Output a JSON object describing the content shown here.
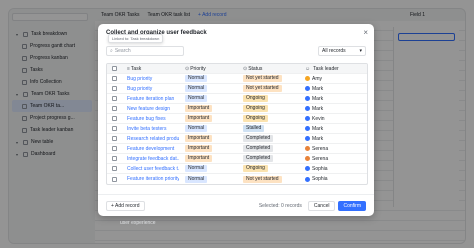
{
  "topbar": {
    "tabs": [
      "Team OKR Tasks",
      "Team OKR task list"
    ],
    "add_record": "+ Add record",
    "field_label": "Field 1"
  },
  "sidebar": {
    "items": [
      {
        "label": "Task breakdown",
        "level": 0
      },
      {
        "label": "Progress gantt chart",
        "level": 1
      },
      {
        "label": "Progress kanban",
        "level": 1
      },
      {
        "label": "Tasks",
        "level": 1
      },
      {
        "label": "Info Collection",
        "level": 1
      },
      {
        "label": "Team OKR Tasks",
        "level": 0
      },
      {
        "label": "Team OKR ta...",
        "level": 1
      },
      {
        "label": "Project progress g...",
        "level": 1
      },
      {
        "label": "Task leader kanban",
        "level": 1
      },
      {
        "label": "New table",
        "level": 0
      },
      {
        "label": "Dashboard",
        "level": 0
      }
    ]
  },
  "modal": {
    "title": "Collect and organize user feedback",
    "tooltip": "Linked to: Task breakdown",
    "search_placeholder": "Search",
    "filter_label": "All records",
    "columns": [
      "Task",
      "Priority",
      "Status",
      "Task leader"
    ],
    "rows": [
      {
        "task": "Bug priority",
        "priority": "Normal",
        "status": "Not yet started",
        "leader": "Amy"
      },
      {
        "task": "Bug priority",
        "priority": "Normal",
        "status": "Not yet started",
        "leader": "Mark"
      },
      {
        "task": "Feature iteration plan",
        "priority": "Normal",
        "status": "Ongoing",
        "leader": "Mark"
      },
      {
        "task": "New feature design",
        "priority": "Important",
        "status": "Ongoing",
        "leader": "Mark"
      },
      {
        "task": "Feature bug fixes",
        "priority": "Important",
        "status": "Ongoing",
        "leader": "Kevin"
      },
      {
        "task": "Invite beta testers",
        "priority": "Normal",
        "status": "Stalled",
        "leader": "Mark"
      },
      {
        "task": "Research related produ...",
        "priority": "Important",
        "status": "Completed",
        "leader": "Mark"
      },
      {
        "task": "Feature development",
        "priority": "Important",
        "status": "Completed",
        "leader": "Serena"
      },
      {
        "task": "Integrate feedback dat...",
        "priority": "Important",
        "status": "Completed",
        "leader": "Serena"
      },
      {
        "task": "Collect user feedback t...",
        "priority": "Normal",
        "status": "Ongoing",
        "leader": "Sophia"
      },
      {
        "task": "Feature iteration priority",
        "priority": "Normal",
        "status": "Not yet started",
        "leader": "Sophia"
      }
    ],
    "add_record": "+ Add record",
    "selected": "Selected: 0 records",
    "cancel": "Cancel",
    "confirm": "Confirm"
  },
  "below": {
    "text": "user experience"
  },
  "colors": {
    "Normal": "#d9e6ff",
    "Important": "#fde2c2",
    "Not yet started": "#fde2c2",
    "Ongoing": "#fbe3b0",
    "Stalled": "#cfe1f3",
    "Completed": "#e3e5e8",
    "Amy": "#f5a623",
    "Mark": "#3370ff",
    "Kevin": "#3370ff",
    "Serena": "#e8833a",
    "Sophia": "#3370ff"
  }
}
